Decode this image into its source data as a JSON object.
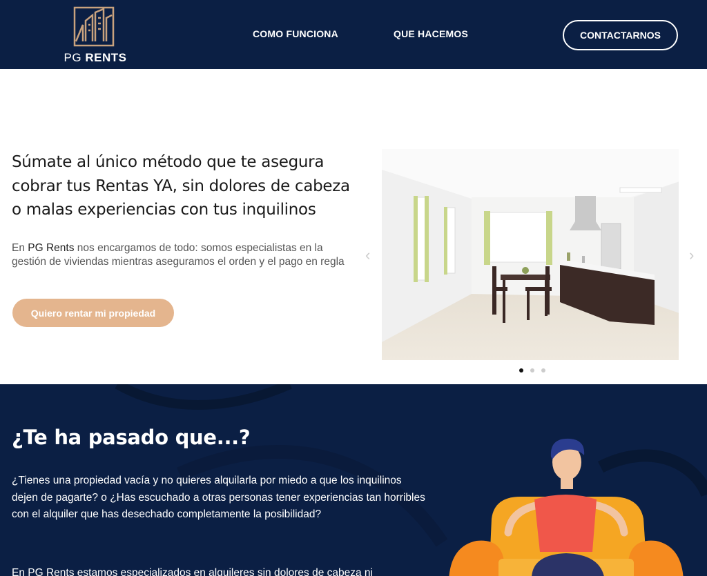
{
  "header": {
    "logo_text_pg": "PG",
    "logo_text_rents": "RENTS",
    "nav": [
      "COMO FUNCIONA",
      "QUE HACEMOS"
    ],
    "contact_label": "CONTACTARNOS"
  },
  "hero": {
    "title": "Súmate al único método que te asegura cobrar tus Rentas YA, sin dolores de cabeza o malas experiencias con tus inquilinos",
    "desc_prefix": "En ",
    "desc_brand": "PG Rents",
    "desc_rest": " nos encargamos de todo: somos especialistas en la gestión de viviendas mientras aseguramos el orden y el pago en regla",
    "cta_label": "Quiero rentar mi propiedad",
    "slider": {
      "prev_icon": "chevron-left-icon",
      "next_icon": "chevron-right-icon",
      "dots_count": 3,
      "active_index": 0
    }
  },
  "section2": {
    "title": "¿Te ha pasado que...?",
    "p1": "¿Tienes una propiedad vacía y no quieres alquilarla por miedo a que los inquilinos dejen de pagarte? o ¿Has escuchado a otras personas tener experiencias tan horribles con el alquiler que has desechado completamente la posibilidad?",
    "p2": "En PG Rents estamos especializados en alquileres sin dolores de cabeza ni"
  },
  "colors": {
    "navy": "#0b1f44",
    "accent": "#e4b58e",
    "logo_gold": "#c9a27e"
  }
}
